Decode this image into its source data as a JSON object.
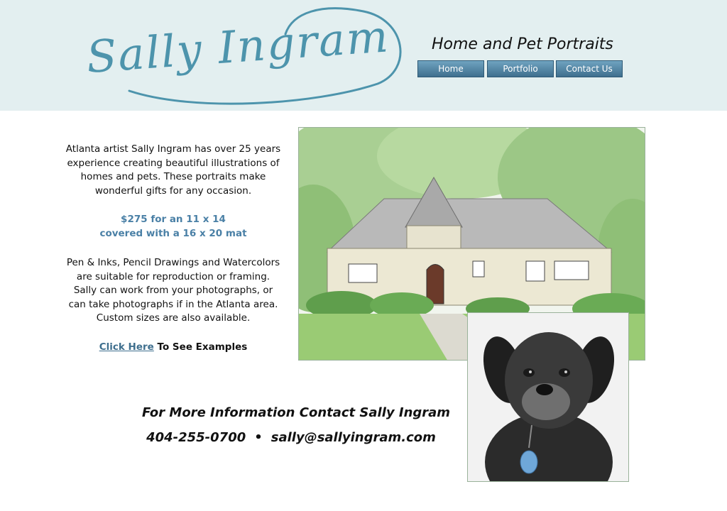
{
  "header": {
    "logo_text": "Sally Ingram",
    "tagline": "Home and Pet Portraits",
    "nav": [
      {
        "label": "Home"
      },
      {
        "label": "Portfolio"
      },
      {
        "label": "Contact Us"
      }
    ]
  },
  "intro": {
    "text": "Atlanta artist Sally Ingram has over 25 years experience creating beautiful illustrations of homes and pets. These portraits make wonderful gifts for any occasion."
  },
  "price": {
    "line1": "$275 for an 11 x 14",
    "line2": "covered with a 16 x 20 mat"
  },
  "details": {
    "text": "Pen & Inks, Pencil Drawings and Watercolors are suitable for reproduction or framing. Sally can work from your photographs, or can take photographs if in the Atlanta area. Custom sizes are also available."
  },
  "examples": {
    "link_label": "Click Here",
    "suffix": " To See Examples"
  },
  "contact": {
    "title": "For More Information Contact Sally Ingram",
    "phone": "404-255-0700",
    "separator": "•",
    "email": "sally@sallyingram.com"
  },
  "colors": {
    "header_bg": "#e3eff0",
    "logo": "#4d94ac",
    "nav_button": "#4f7f9f",
    "price_text": "#4a80a6",
    "link": "#3f6f8e"
  },
  "images": {
    "house": "watercolor-house-portrait",
    "dog": "pet-portrait-dog"
  }
}
